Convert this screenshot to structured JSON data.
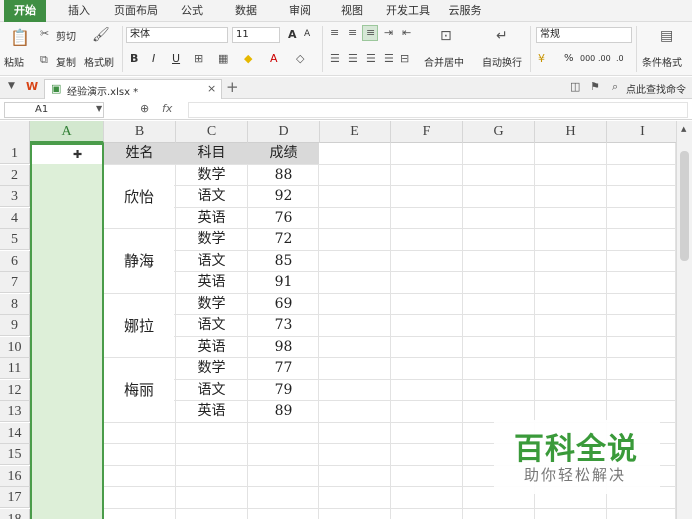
{
  "menu": {
    "tabs": [
      "开始",
      "插入",
      "页面布局",
      "公式",
      "数据",
      "审阅",
      "视图",
      "开发工具",
      "云服务"
    ],
    "active": 0
  },
  "ribbon": {
    "paste": "粘贴",
    "cut": "剪切",
    "copy": "复制",
    "format_painter": "格式刷",
    "font_name": "宋体",
    "font_size": "11",
    "bold": "B",
    "italic": "I",
    "underline": "U",
    "grow_font": "A",
    "shrink_font": "A",
    "merge_center": "合并居中",
    "wrap_text": "自动换行",
    "number_format": "常规",
    "percent": "%",
    "thousands": "000",
    "inc_decimal": ".00",
    "dec_decimal": ".0",
    "conditional_format": "条件格式"
  },
  "tabbar": {
    "doc_name": "经验演示.xlsx *",
    "add_tab": "+",
    "find_command": "点此查找命令"
  },
  "formula": {
    "name_box": "A1",
    "fx": "fx",
    "value": ""
  },
  "sheet": {
    "columns": [
      "A",
      "B",
      "C",
      "D",
      "E",
      "F",
      "G",
      "H",
      "I"
    ],
    "rows": [
      "1",
      "2",
      "3",
      "4",
      "5",
      "6",
      "7",
      "8",
      "9",
      "10",
      "11",
      "12",
      "13",
      "14",
      "15",
      "16",
      "17",
      "18"
    ],
    "header": {
      "name": "姓名",
      "subject": "科目",
      "score": "成绩"
    },
    "students": [
      {
        "name": "欣怡",
        "records": [
          {
            "subject": "数学",
            "score": "88"
          },
          {
            "subject": "语文",
            "score": "92"
          },
          {
            "subject": "英语",
            "score": "76"
          }
        ]
      },
      {
        "name": "静海",
        "records": [
          {
            "subject": "数学",
            "score": "72"
          },
          {
            "subject": "语文",
            "score": "85"
          },
          {
            "subject": "英语",
            "score": "91"
          }
        ]
      },
      {
        "name": "娜拉",
        "records": [
          {
            "subject": "数学",
            "score": "69"
          },
          {
            "subject": "语文",
            "score": "73"
          },
          {
            "subject": "英语",
            "score": "98"
          }
        ]
      },
      {
        "name": "梅丽",
        "records": [
          {
            "subject": "数学",
            "score": "77"
          },
          {
            "subject": "语文",
            "score": "79"
          },
          {
            "subject": "英语",
            "score": "89"
          }
        ]
      }
    ]
  },
  "watermark": {
    "title": "百科全说",
    "subtitle": "助你轻松解决"
  },
  "colors": {
    "accent": "#3f8f43",
    "selection": "#ddefd8",
    "selection_border": "#4a9c4a",
    "header_fill": "#d9d9d9"
  }
}
